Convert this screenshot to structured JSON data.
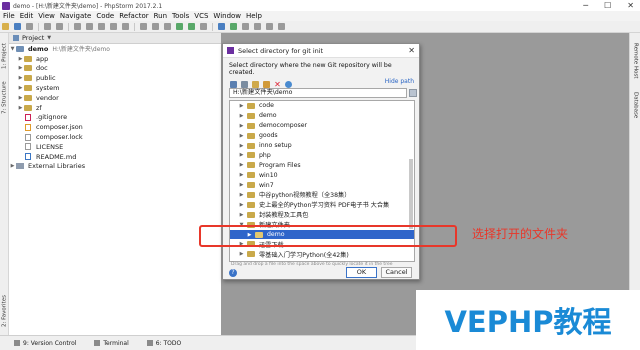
{
  "titlebar": {
    "title": "demo - [H:\\新建文件夹\\demo] - PhpStorm 2017.2.1",
    "minimize": "─",
    "maximize": "☐",
    "close": "✕"
  },
  "menu": [
    "File",
    "Edit",
    "View",
    "Navigate",
    "Code",
    "Refactor",
    "Run",
    "Tools",
    "VCS",
    "Window",
    "Help"
  ],
  "left_tool_tabs": [
    "1: Project",
    "7: Structure",
    "2: Favorites"
  ],
  "right_tool_tabs": [
    "Remote Host",
    "Database"
  ],
  "project_panel": {
    "header": "Project",
    "root": {
      "name": "demo",
      "path": "H:\\新建文件夹\\demo"
    },
    "items": [
      {
        "type": "folder",
        "label": "app"
      },
      {
        "type": "folder",
        "label": "doc"
      },
      {
        "type": "folder",
        "label": "public"
      },
      {
        "type": "folder",
        "label": "system"
      },
      {
        "type": "folder",
        "label": "vendor"
      },
      {
        "type": "folder",
        "label": "zf"
      },
      {
        "type": "file",
        "label": ".gitignore"
      },
      {
        "type": "file",
        "label": "composer.json"
      },
      {
        "type": "file",
        "label": "composer.lock"
      },
      {
        "type": "file",
        "label": "LICENSE"
      },
      {
        "type": "file",
        "label": "README.md"
      }
    ],
    "external": "External Libraries"
  },
  "dialog": {
    "title": "Select directory for git init",
    "description": "Select directory where the new Git repository will be created.",
    "hide_path": "Hide path",
    "path_value": "H:\\新建文件夹\\demo",
    "tree": [
      {
        "label": "code",
        "level": 0
      },
      {
        "label": "demo",
        "level": 0
      },
      {
        "label": "democomposer",
        "level": 0
      },
      {
        "label": "goods",
        "level": 0
      },
      {
        "label": "inno setup",
        "level": 0
      },
      {
        "label": "php",
        "level": 0
      },
      {
        "label": "Program Files",
        "level": 0
      },
      {
        "label": "win10",
        "level": 0
      },
      {
        "label": "win7",
        "level": 0
      },
      {
        "label": "中谷python视频教程（全38集）",
        "level": 0
      },
      {
        "label": "史上最全的Python学习资料 PDF电子书 大合集",
        "level": 0
      },
      {
        "label": "封装教程及工具包",
        "level": 0
      },
      {
        "label": "新建文件夹",
        "level": 0
      },
      {
        "label": "demo",
        "level": 1,
        "selected": true
      },
      {
        "label": "迅雷下载",
        "level": 0
      },
      {
        "label": "零基础入门学习Python(全42集)",
        "level": 0
      }
    ],
    "drop_hint": "Drag and drop a file into the space above to quickly locate it in the tree",
    "help": "?",
    "ok": "OK",
    "cancel": "Cancel"
  },
  "bottom_bar": [
    "9: Version Control",
    "Terminal",
    "6: TODO"
  ],
  "annotation": {
    "text": "选择打开的文件夹",
    "color": "#e8372a"
  },
  "watermark": {
    "text": "VEPHP教程",
    "color": "#1a8ad6"
  }
}
